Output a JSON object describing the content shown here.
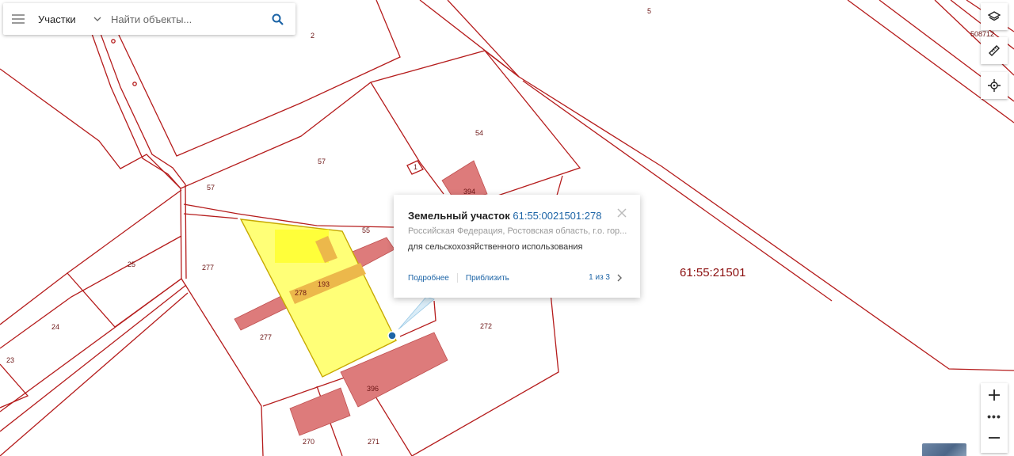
{
  "search": {
    "layer_label": "Участки",
    "placeholder": "Найти объекты..."
  },
  "popup": {
    "title": "Земельный участок",
    "cadastral_number": "61:55:0021501:278",
    "address": "Российская Федерация, Ростовская область, г.о. гор...",
    "usage": "для сельскохозяйственного использования",
    "details_link": "Подробнее",
    "zoom_link": "Приблизить",
    "pager": "1 из 3"
  },
  "map": {
    "quarter_label": "61:55:21501",
    "parcel_labels": [
      "5",
      "2",
      "57",
      "54",
      "1",
      "57",
      "55",
      "25",
      "277",
      "24",
      "23",
      "277",
      "278",
      "193",
      "272",
      "396",
      "270",
      "271",
      "394",
      "508712"
    ]
  },
  "zoom": {
    "plus": "+",
    "more": "•••",
    "minus": "−"
  },
  "colors": {
    "boundary": "#b51c1c",
    "selected_fill": "#ffff77",
    "building_fill": "#dd7b7b",
    "link": "#1c64a6",
    "accent_blue": "#1c64a6"
  }
}
